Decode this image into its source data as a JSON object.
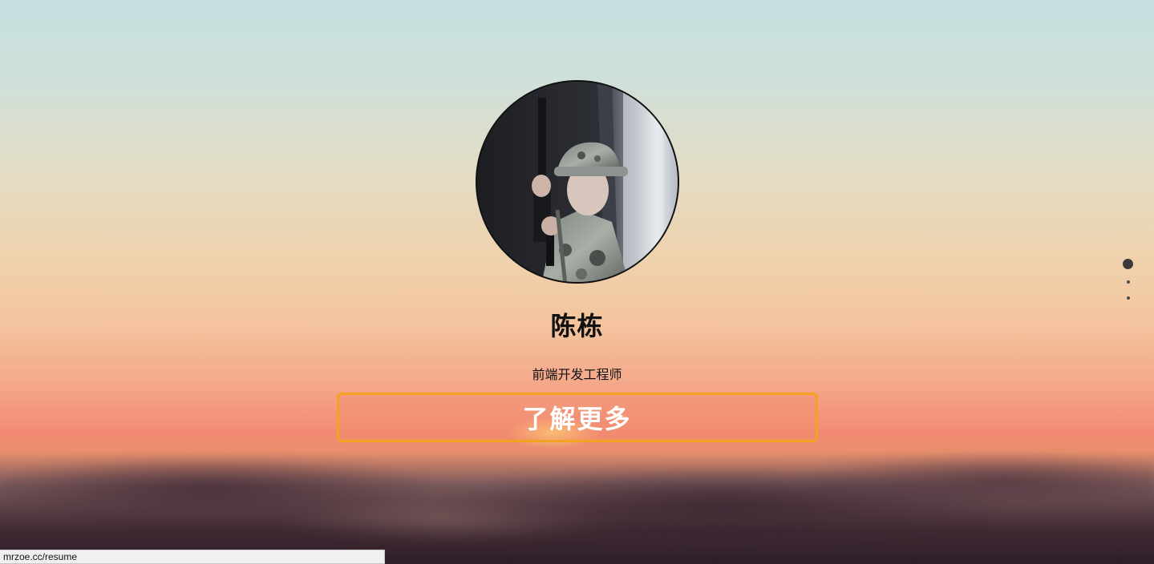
{
  "profile": {
    "name": "陈栋",
    "title": "前端开发工程师",
    "avatar_alt": "soldier-portrait"
  },
  "cta": {
    "label": "了解更多"
  },
  "pagination": {
    "count": 3,
    "active_index": 0
  },
  "status_bar": {
    "url": "mrzoe.cc/resume"
  },
  "colors": {
    "cta_border": "#f3a31d",
    "text_dark": "#111111",
    "cta_text": "#ffffff"
  }
}
